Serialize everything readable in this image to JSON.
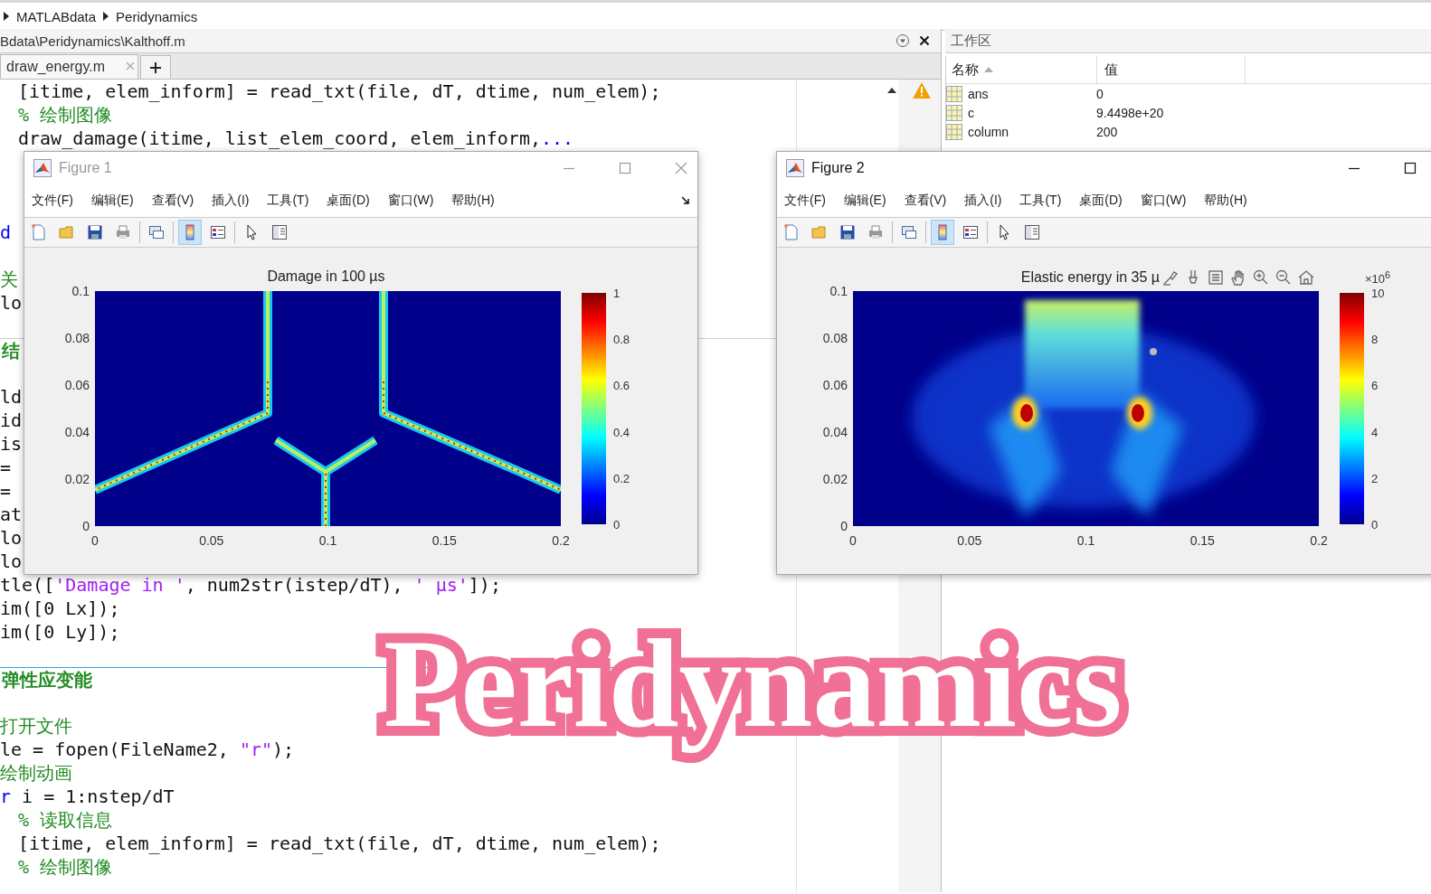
{
  "breadcrumb": [
    "MATLABdata",
    "Peridynamics"
  ],
  "editor": {
    "path": "Bdata\\Peridynamics\\Kalthoff.m",
    "tabs": [
      {
        "label": "draw_energy.m",
        "selected": true
      }
    ],
    "lines": [
      {
        "kind": "code",
        "indent": true,
        "tokens": [
          {
            "kind": "code",
            "text": "[itime, elem_inform] = read_txt(file, dT, dtime, num_elem);"
          }
        ]
      },
      {
        "kind": "code",
        "indent": true,
        "tokens": [
          {
            "kind": "comment",
            "text": "% 绘制图像"
          }
        ]
      },
      {
        "kind": "code",
        "indent": true,
        "tokens": [
          {
            "kind": "code",
            "text": "draw_damage(itime, list_elem_coord, elem_inform,"
          },
          {
            "kind": "keyword",
            "text": "..."
          }
        ]
      },
      {
        "kind": "blank"
      },
      {
        "kind": "blank"
      },
      {
        "kind": "blank"
      },
      {
        "kind": "code",
        "indent": false,
        "tokens": [
          {
            "kind": "keyword",
            "text": "d"
          }
        ]
      },
      {
        "kind": "blank"
      },
      {
        "kind": "code",
        "indent": false,
        "tokens": [
          {
            "kind": "comment",
            "text": "关"
          }
        ]
      },
      {
        "kind": "code",
        "indent": false,
        "tokens": [
          {
            "kind": "code",
            "text": "lo"
          }
        ]
      },
      {
        "kind": "blank"
      },
      {
        "kind": "section",
        "current": false,
        "tokens": [
          {
            "kind": "comment",
            "text": "结"
          }
        ]
      },
      {
        "kind": "blank"
      },
      {
        "kind": "code",
        "indent": false,
        "tokens": [
          {
            "kind": "code",
            "text": "ld"
          }
        ]
      },
      {
        "kind": "code",
        "indent": false,
        "tokens": [
          {
            "kind": "code",
            "text": "id"
          }
        ]
      },
      {
        "kind": "code",
        "indent": false,
        "tokens": [
          {
            "kind": "code",
            "text": "is"
          }
        ]
      },
      {
        "kind": "code",
        "indent": false,
        "tokens": [
          {
            "kind": "code",
            "text": "="
          }
        ]
      },
      {
        "kind": "code",
        "indent": false,
        "tokens": [
          {
            "kind": "code",
            "text": "="
          }
        ]
      },
      {
        "kind": "code",
        "indent": false,
        "tokens": [
          {
            "kind": "code",
            "text": "at"
          }
        ]
      },
      {
        "kind": "code",
        "indent": false,
        "tokens": [
          {
            "kind": "code",
            "text": "lo"
          }
        ]
      },
      {
        "kind": "code",
        "indent": false,
        "tokens": [
          {
            "kind": "code",
            "text": "lo"
          }
        ]
      },
      {
        "kind": "code",
        "indent": false,
        "tokens": [
          {
            "kind": "code",
            "text": "tle(["
          },
          {
            "kind": "string",
            "text": "'Damage in '"
          },
          {
            "kind": "code",
            "text": ", num2str(istep/dT), "
          },
          {
            "kind": "string",
            "text": "' µs'"
          },
          {
            "kind": "code",
            "text": "]);"
          }
        ]
      },
      {
        "kind": "code",
        "indent": false,
        "tokens": [
          {
            "kind": "code",
            "text": "im([0 Lx]);"
          }
        ]
      },
      {
        "kind": "code",
        "indent": false,
        "tokens": [
          {
            "kind": "code",
            "text": "im([0 Ly]);"
          }
        ]
      },
      {
        "kind": "blank"
      },
      {
        "kind": "section",
        "current": true,
        "tokens": [
          {
            "kind": "comment",
            "text": "弹性应变能"
          }
        ]
      },
      {
        "kind": "blank"
      },
      {
        "kind": "code",
        "indent": false,
        "tokens": [
          {
            "kind": "comment",
            "text": "打开文件"
          }
        ]
      },
      {
        "kind": "code",
        "indent": false,
        "tokens": [
          {
            "kind": "code",
            "text": "le = fopen(FileName2, "
          },
          {
            "kind": "string",
            "text": "\"r\""
          },
          {
            "kind": "code",
            "text": ");"
          }
        ]
      },
      {
        "kind": "code",
        "indent": false,
        "tokens": [
          {
            "kind": "comment",
            "text": "绘制动画"
          }
        ]
      },
      {
        "kind": "code",
        "indent": false,
        "tokens": [
          {
            "kind": "keyword",
            "text": "r"
          },
          {
            "kind": "code",
            "text": " i = 1:nstep/dT"
          }
        ]
      },
      {
        "kind": "code",
        "indent": true,
        "tokens": [
          {
            "kind": "comment",
            "text": "% 读取信息"
          }
        ]
      },
      {
        "kind": "code",
        "indent": true,
        "tokens": [
          {
            "kind": "code",
            "text": "[itime, elem_inform] = read_txt(file, dT, dtime, num_elem);"
          }
        ]
      },
      {
        "kind": "code",
        "indent": true,
        "tokens": [
          {
            "kind": "comment",
            "text": "% 绘制图像"
          }
        ]
      }
    ]
  },
  "workspace": {
    "title": "工作区",
    "columns": [
      "名称",
      "值"
    ],
    "rows": [
      {
        "name": "ans",
        "value": "0"
      },
      {
        "name": "c",
        "value": "9.4498e+20"
      },
      {
        "name": "column",
        "value": "200"
      }
    ]
  },
  "figures": [
    {
      "title": "Figure 1",
      "active": false,
      "controls": [
        {
          "kind": "minimize"
        },
        {
          "kind": "maximize"
        },
        {
          "kind": "close"
        }
      ],
      "dock": true,
      "menu": [
        "文件(F)",
        "编辑(E)",
        "查看(V)",
        "插入(I)",
        "工具(T)",
        "桌面(D)",
        "窗口(W)",
        "帮助(H)"
      ],
      "toolbar": [
        {
          "kind": "new",
          "selected": false
        },
        {
          "kind": "open",
          "selected": false
        },
        {
          "kind": "save",
          "selected": false
        },
        {
          "kind": "print",
          "selected": false
        },
        {
          "kind": "separator"
        },
        {
          "kind": "link",
          "selected": false
        },
        {
          "kind": "separator"
        },
        {
          "kind": "colorbar",
          "selected": true
        },
        {
          "kind": "legend",
          "selected": false
        },
        {
          "kind": "separator"
        },
        {
          "kind": "pointer",
          "selected": false
        },
        {
          "kind": "inspector",
          "selected": false
        }
      ],
      "plot": {
        "kind": "damage",
        "title": "Damage in 100 µs",
        "yticks": [
          "0.1",
          "0.08",
          "0.06",
          "0.04",
          "0.02",
          "0"
        ],
        "xticks": [
          "0",
          "0.05",
          "0.1",
          "0.15",
          "0.2"
        ],
        "colorbar_ticks": [
          "1",
          "0.8",
          "0.6",
          "0.4",
          "0.2",
          "0"
        ]
      }
    },
    {
      "title": "Figure 2",
      "active": true,
      "controls": [
        {
          "kind": "minimize"
        },
        {
          "kind": "maximize"
        }
      ],
      "menu": [
        "文件(F)",
        "编辑(E)",
        "查看(V)",
        "插入(I)",
        "工具(T)",
        "桌面(D)",
        "窗口(W)",
        "帮助(H)"
      ],
      "toolbar": [
        {
          "kind": "new",
          "selected": false
        },
        {
          "kind": "open",
          "selected": false
        },
        {
          "kind": "save",
          "selected": false
        },
        {
          "kind": "print",
          "selected": false
        },
        {
          "kind": "separator"
        },
        {
          "kind": "link",
          "selected": false
        },
        {
          "kind": "separator"
        },
        {
          "kind": "colorbar",
          "selected": true
        },
        {
          "kind": "legend",
          "selected": false
        },
        {
          "kind": "separator"
        },
        {
          "kind": "pointer",
          "selected": false
        },
        {
          "kind": "inspector",
          "selected": false
        }
      ],
      "plot": {
        "kind": "energy",
        "title": "Elastic energy in 35 µ",
        "exponent": "×10$^{6}$",
        "axes_toolbar": [
          {
            "kind": "brush"
          },
          {
            "kind": "datatip"
          },
          {
            "kind": "legend"
          },
          {
            "kind": "pan"
          },
          {
            "kind": "zoom-in"
          },
          {
            "kind": "zoom-out"
          },
          {
            "kind": "home"
          }
        ],
        "yticks": [
          "0.1",
          "0.08",
          "0.06",
          "0.04",
          "0.02",
          "0"
        ],
        "xticks": [
          "0",
          "0.05",
          "0.1",
          "0.15",
          "0.2"
        ],
        "colorbar_ticks": [
          "10",
          "8",
          "6",
          "4",
          "2",
          "0"
        ]
      }
    }
  ],
  "overlay_title": "Peridynamics"
}
